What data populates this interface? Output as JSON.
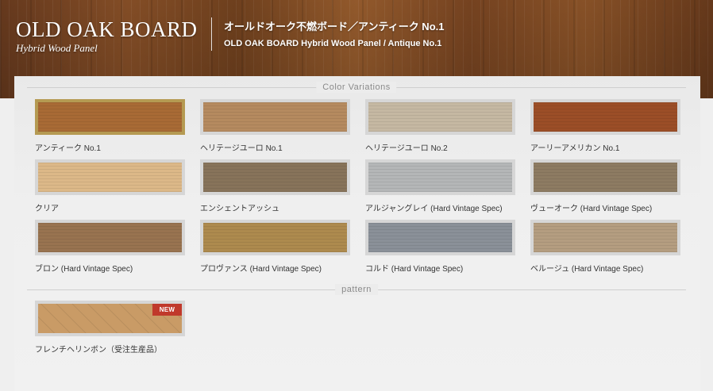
{
  "header": {
    "brand_title": "OLD OAK BOARD",
    "brand_subtitle": "Hybrid Wood Panel",
    "product_name_jp": "オールドオーク不燃ボード／アンティーク No.1",
    "product_name_en": "OLD OAK BOARD Hybrid Wood Panel / Antique No.1"
  },
  "sections": {
    "color_variations_title": "Color Variations",
    "pattern_title": "pattern"
  },
  "color_variations": [
    {
      "label": "アンティーク No.1",
      "color": "#a86a35",
      "selected": true
    },
    {
      "label": "ヘリテージユーロ No.1",
      "color": "#b58a5f",
      "selected": false
    },
    {
      "label": "ヘリテージユーロ No.2",
      "color": "#c5b8a2",
      "selected": false
    },
    {
      "label": "アーリーアメリカン No.1",
      "color": "#9b4e27",
      "selected": false
    },
    {
      "label": "クリア",
      "color": "#dcb888",
      "selected": false
    },
    {
      "label": "エンシェントアッシュ",
      "color": "#87735a",
      "selected": false
    },
    {
      "label": "アルジャングレイ (Hard Vintage Spec)",
      "color": "#b4b6b7",
      "selected": false
    },
    {
      "label": "ヴューオーク (Hard Vintage Spec)",
      "color": "#8d7b62",
      "selected": false
    },
    {
      "label": "ブロン (Hard Vintage Spec)",
      "color": "#987350",
      "selected": false
    },
    {
      "label": "プロヴァンス (Hard Vintage Spec)",
      "color": "#ad8a4e",
      "selected": false
    },
    {
      "label": "コルド (Hard Vintage Spec)",
      "color": "#8a9098",
      "selected": false
    },
    {
      "label": "ベルージュ (Hard Vintage Spec)",
      "color": "#b49d80",
      "selected": false
    }
  ],
  "patterns": [
    {
      "label": "フレンチヘリンボン（受注生産品）",
      "color": "#c99b66",
      "badge": "NEW"
    }
  ]
}
